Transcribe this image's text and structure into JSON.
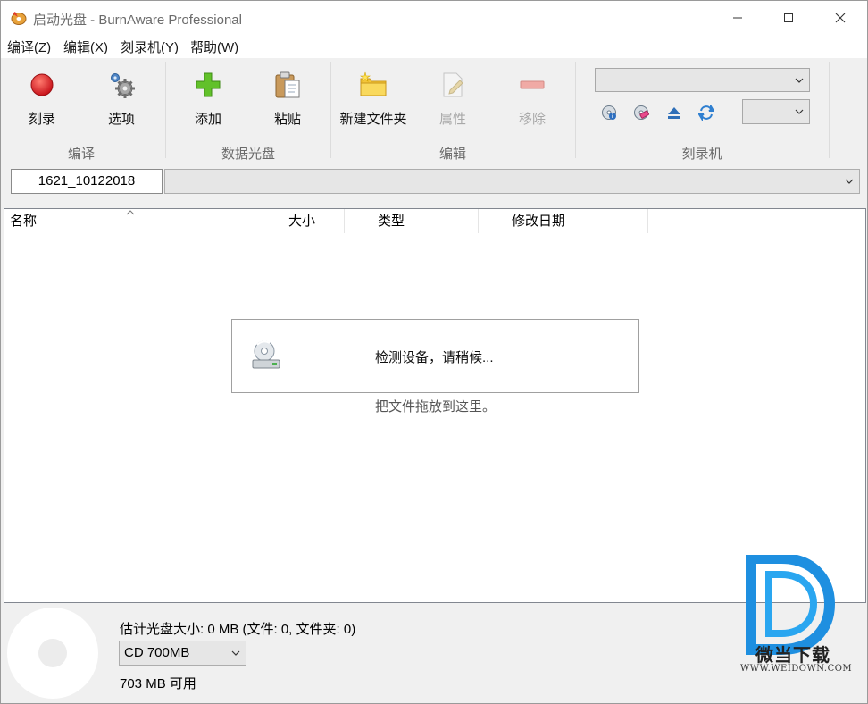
{
  "window": {
    "title": "启动光盘 - BurnAware Professional",
    "controls": {
      "minimize": "minimize-icon",
      "maximize": "maximize-icon",
      "close": "close-icon"
    }
  },
  "menu": {
    "items": [
      {
        "label": "编译(Z)"
      },
      {
        "label": "编辑(X)"
      },
      {
        "label": "刻录机(Y)"
      },
      {
        "label": "帮助(W)"
      }
    ]
  },
  "ribbon": {
    "groups": {
      "compile": {
        "label": "编译",
        "buttons": {
          "burn": "刻录",
          "options": "选项"
        }
      },
      "data_disc": {
        "label": "数据光盘",
        "buttons": {
          "add": "添加",
          "paste": "粘贴"
        }
      },
      "edit": {
        "label": "编辑",
        "buttons": {
          "new_folder": "新建文件夹",
          "properties": "属性",
          "remove": "移除"
        }
      },
      "burner": {
        "label": "刻录机",
        "drive_select": "",
        "speed_select": ""
      }
    }
  },
  "path": {
    "disc_label": "1621_10122018",
    "location": ""
  },
  "file_list": {
    "columns": [
      {
        "label": "名称"
      },
      {
        "label": "大小"
      },
      {
        "label": "类型"
      },
      {
        "label": "修改日期"
      }
    ],
    "rows": [],
    "detecting_message": "检测设备，请稍候...",
    "drop_hint": "把文件拖放到这里。"
  },
  "status": {
    "estimate": "估计光盘大小: 0 MB (文件: 0, 文件夹: 0)",
    "disc_type": "CD 700MB",
    "available": "703 MB 可用"
  },
  "watermark": {
    "brand": "微当下载",
    "url": "WWW.WEIDOWN.COM"
  },
  "colors": {
    "burn_red": "#d9262b",
    "add_green": "#5cb82a",
    "folder_yellow": "#f5cd3b",
    "watermark_blue": "#1e8fe0"
  }
}
